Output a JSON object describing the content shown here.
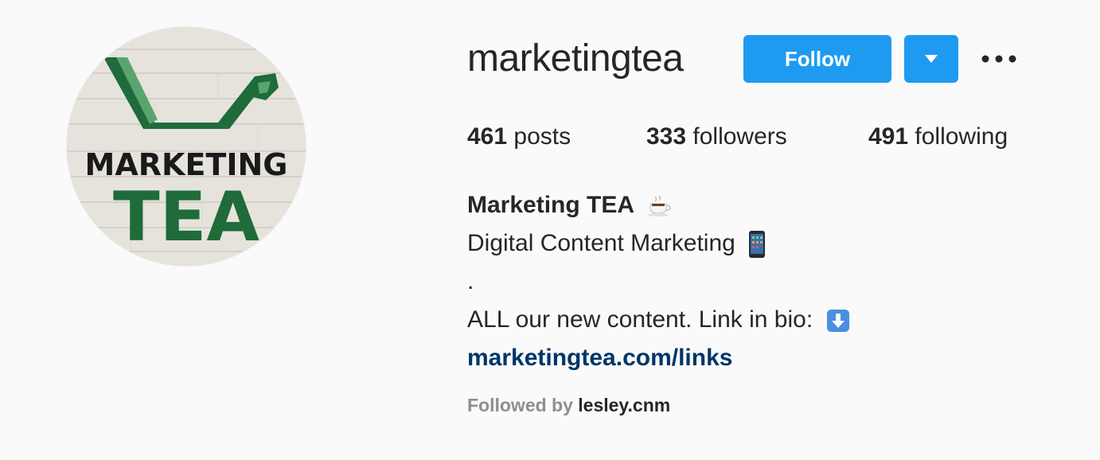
{
  "profile": {
    "username": "marketingtea",
    "follow_label": "Follow",
    "avatar_text": [
      "MARKETING",
      "TEA"
    ]
  },
  "stats": {
    "posts_count": "461",
    "posts_label": " posts",
    "followers_count": "333",
    "followers_label": " followers",
    "following_count": "491",
    "following_label": " following"
  },
  "bio": {
    "name": "Marketing TEA",
    "line1": "Digital Content Marketing",
    "line2": ".",
    "line3": "ALL our new content. Link in bio:",
    "link": "marketingtea.com/links"
  },
  "followed_by": {
    "label": "Followed by ",
    "user": "lesley.cnm"
  },
  "icons": [
    "teacup-icon",
    "mobile-phone-icon",
    "down-arrow-icon",
    "chevron-down-icon",
    "more-options-icon"
  ],
  "colors": {
    "accent": "#1e9bf0",
    "link": "#003569",
    "brand_green": "#1f6b3a"
  }
}
